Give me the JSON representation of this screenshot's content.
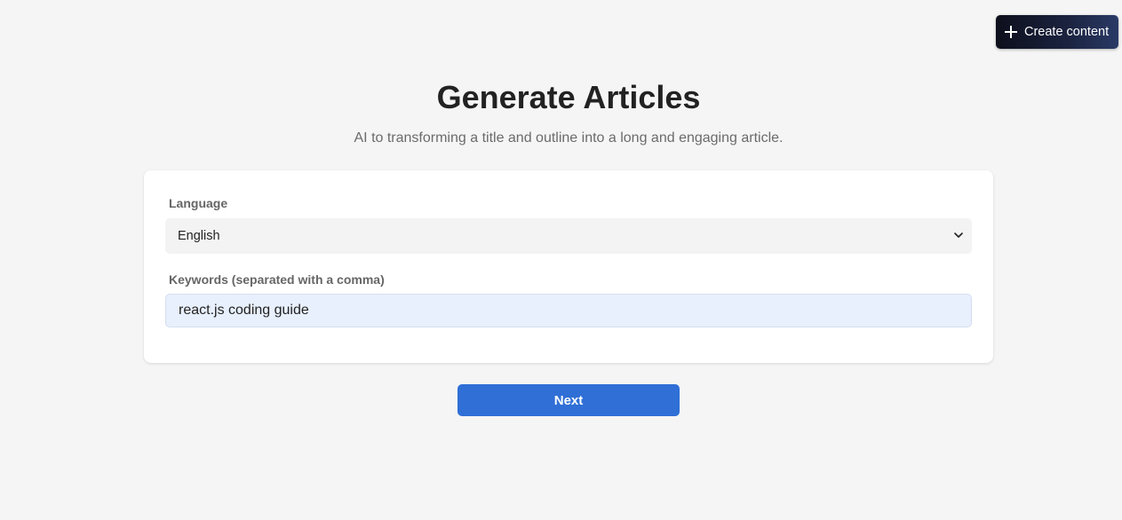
{
  "header": {
    "create_button_label": "Create content",
    "create_button_icon": "plus-icon"
  },
  "main": {
    "title": "Generate Articles",
    "subtitle": "AI to transforming a title and outline into a long and engaging article."
  },
  "form": {
    "language_label": "Language",
    "language_selected": "English",
    "language_icon": "chevron-down-icon",
    "keywords_label": "Keywords (separated with a comma)",
    "keywords_value": "react.js coding guide"
  },
  "actions": {
    "next_label": "Next"
  },
  "colors": {
    "background": "#f5f5f5",
    "primary": "#2f6fd6",
    "input_autofill": "#e8f0fe",
    "dark_button": "#0d0f1c"
  }
}
